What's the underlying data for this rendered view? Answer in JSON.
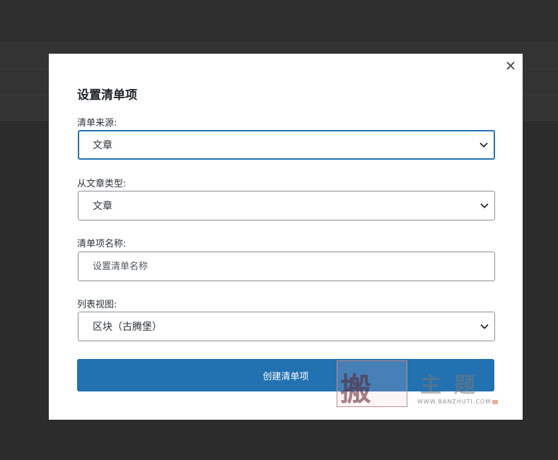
{
  "modal": {
    "title": "设置清单项",
    "close_glyph": "✕",
    "fields": {
      "source": {
        "label": "清单来源:",
        "value": "文章"
      },
      "post_type": {
        "label": "从文章类型:",
        "value": "文章"
      },
      "name": {
        "label": "清单项名称:",
        "placeholder": "设置清单名称",
        "value": ""
      },
      "list_view": {
        "label": "列表视图:",
        "value": "区块（古腾堡）"
      }
    },
    "submit_label": "创建清单项"
  },
  "watermark": {
    "seal_text": "搬",
    "text": "主题",
    "url": "WWW.BANZHUTI.COM"
  },
  "colors": {
    "accent": "#2271b1",
    "overlay": "#2f2f2f",
    "border": "#8c8f94"
  },
  "icons": {
    "close": "close-icon",
    "dropdown": "chevron-down-icon"
  }
}
